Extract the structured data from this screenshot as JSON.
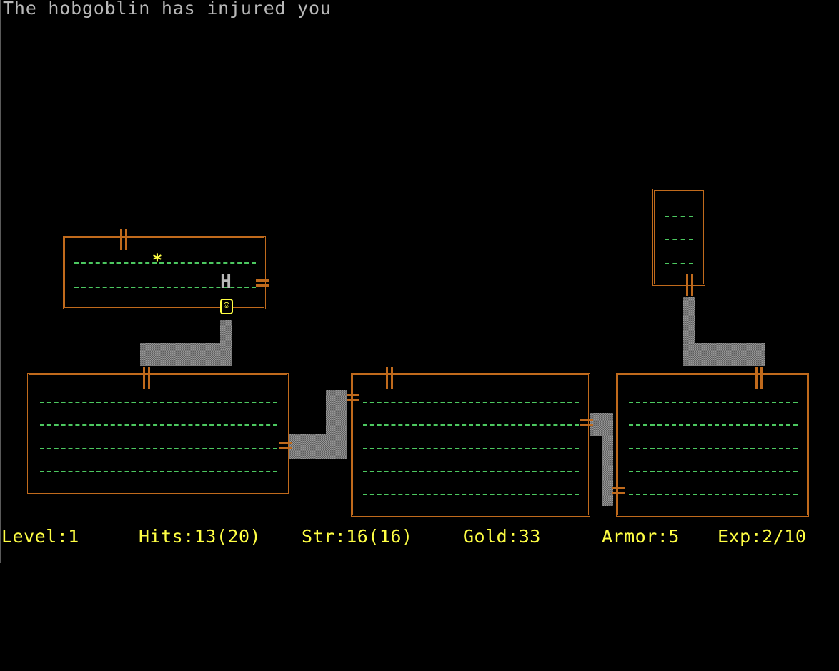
{
  "message": "The hobgoblin has injured you",
  "glyphs": {
    "hobgoblin": "H",
    "gold": "*",
    "player": "☺"
  },
  "status": {
    "level": "Level:1",
    "hits": "Hits:13(20)",
    "strength": "Str:16(16)",
    "gold": "Gold:33",
    "armor": "Armor:5",
    "experience": "Exp:2/10"
  },
  "colors": {
    "wall": "#c06a1c",
    "floor": "#4cc860",
    "status_text": "#ffff44",
    "message_text": "#b8b8b8",
    "hobgoblin": "#b8b8b8",
    "player": "#ffff44"
  }
}
